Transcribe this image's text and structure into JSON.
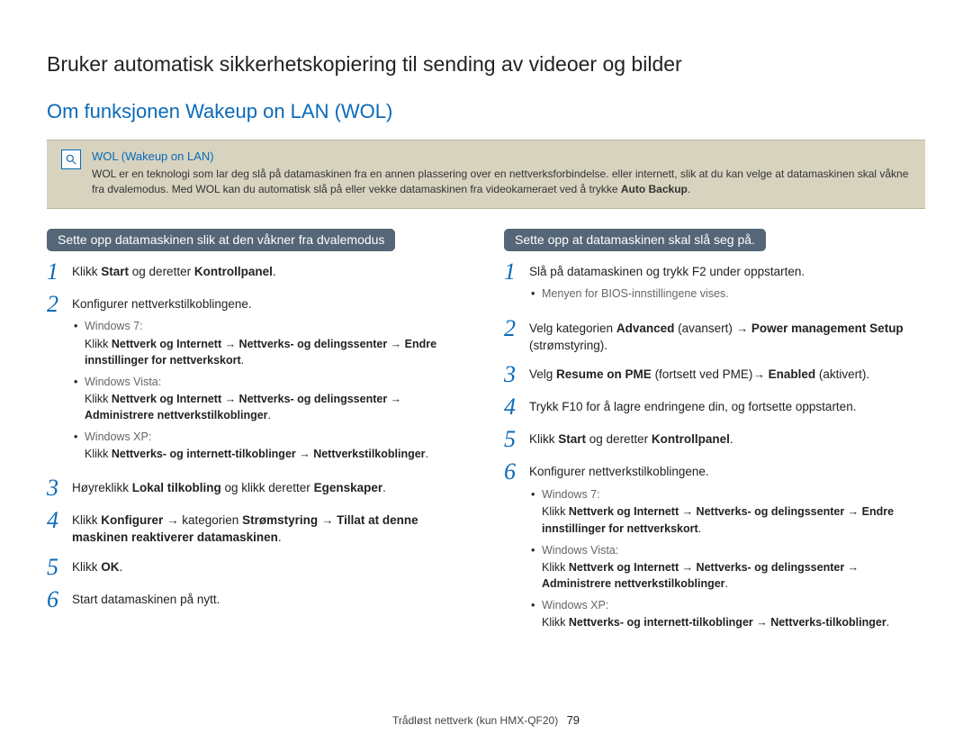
{
  "page_title": "Bruker automatisk sikkerhetskopiering til sending av videoer og bilder",
  "section_title": "Om funksjonen Wakeup on LAN (WOL)",
  "info": {
    "title": "WOL (Wakeup on LAN)",
    "body_pre": "WOL er en teknologi som lar deg slå på datamaskinen fra en annen plassering over en nettverksforbindelse. eller internett, slik at du kan velge at datamaskinen skal våkne fra dvalemodus. Med WOL kan du automatisk slå på eller vekke datamaskinen fra videokameraet ved å trykke ",
    "body_bold": "Auto Backup",
    "body_post": "."
  },
  "left": {
    "header": "Sette opp datamaskinen slik at den våkner fra dvalemodus",
    "steps": {
      "s1": {
        "pre": "Klikk ",
        "b1": "Start",
        "mid": " og deretter ",
        "b2": "Kontrollpanel",
        "post": "."
      },
      "s2": {
        "text": "Konfigurer nettverkstilkoblingene.",
        "os": {
          "w7": {
            "label": "Windows 7:",
            "body_pre": "Klikk ",
            "body_bold": "Nettverk og Internett → Nettverks- og delingssenter → Endre innstillinger for nettverkskort",
            "body_post": "."
          },
          "vista": {
            "label": "Windows Vista:",
            "body_pre": "Klikk ",
            "body_bold": "Nettverk og Internett → Nettverks- og delingssenter → Administrere nettverkstilkoblinger",
            "body_post": "."
          },
          "xp": {
            "label": "Windows XP:",
            "body_pre": "Klikk ",
            "body_bold": "Nettverks- og internett-tilkoblinger → Nettverkstilkoblinger",
            "body_post": "."
          }
        }
      },
      "s3": {
        "pre": "Høyreklikk ",
        "b1": "Lokal tilkobling",
        "mid": " og klikk deretter ",
        "b2": "Egenskaper",
        "post": "."
      },
      "s4": {
        "pre": "Klikk ",
        "b1": "Konfigurer",
        "mid1": " → kategorien ",
        "b2": "Strømstyring",
        "mid2": " → ",
        "b3": "Tillat at denne maskinen reaktiverer datamaskinen",
        "post": "."
      },
      "s5": {
        "pre": "Klikk ",
        "b1": "OK",
        "post": "."
      },
      "s6": {
        "text": "Start datamaskinen på nytt."
      }
    }
  },
  "right": {
    "header": "Sette opp at datamaskinen skal slå seg på.",
    "steps": {
      "s1": {
        "text": "Slå på datamaskinen og trykk F2 under oppstarten.",
        "note": "Menyen for BIOS-innstillingene vises."
      },
      "s2": {
        "pre": "Velg kategorien ",
        "b1": "Advanced",
        "mid1": " (avansert) → ",
        "b2": "Power management Setup",
        "mid2": " (strømstyring).",
        "post": ""
      },
      "s3": {
        "pre": "Velg ",
        "b1": "Resume on PME",
        "mid1": " (fortsett ved PME)→ ",
        "b2": "Enabled",
        "mid2": " (aktivert).",
        "post": ""
      },
      "s4": {
        "text": "Trykk F10 for å lagre endringene din, og fortsette oppstarten."
      },
      "s5": {
        "pre": "Klikk ",
        "b1": "Start",
        "mid": " og deretter ",
        "b2": "Kontrollpanel",
        "post": "."
      },
      "s6": {
        "text": "Konfigurer nettverkstilkoblingene.",
        "os": {
          "w7": {
            "label": "Windows 7:",
            "body_pre": "Klikk ",
            "body_bold": "Nettverk og Internett → Nettverks- og delingssenter → Endre innstillinger for nettverkskort",
            "body_post": "."
          },
          "vista": {
            "label": "Windows Vista:",
            "body_pre": "Klikk ",
            "body_bold": "Nettverk og Internett → Nettverks- og delingssenter → Administrere nettverkstilkoblinger",
            "body_post": "."
          },
          "xp": {
            "label": "Windows XP:",
            "body_pre": "Klikk ",
            "body_bold": "Nettverks- og internett-tilkoblinger → Nettverks-tilkoblinger",
            "body_post": "."
          }
        }
      }
    }
  },
  "footer": {
    "text": "Trådløst nettverk (kun HMX-QF20)",
    "page": "79"
  }
}
